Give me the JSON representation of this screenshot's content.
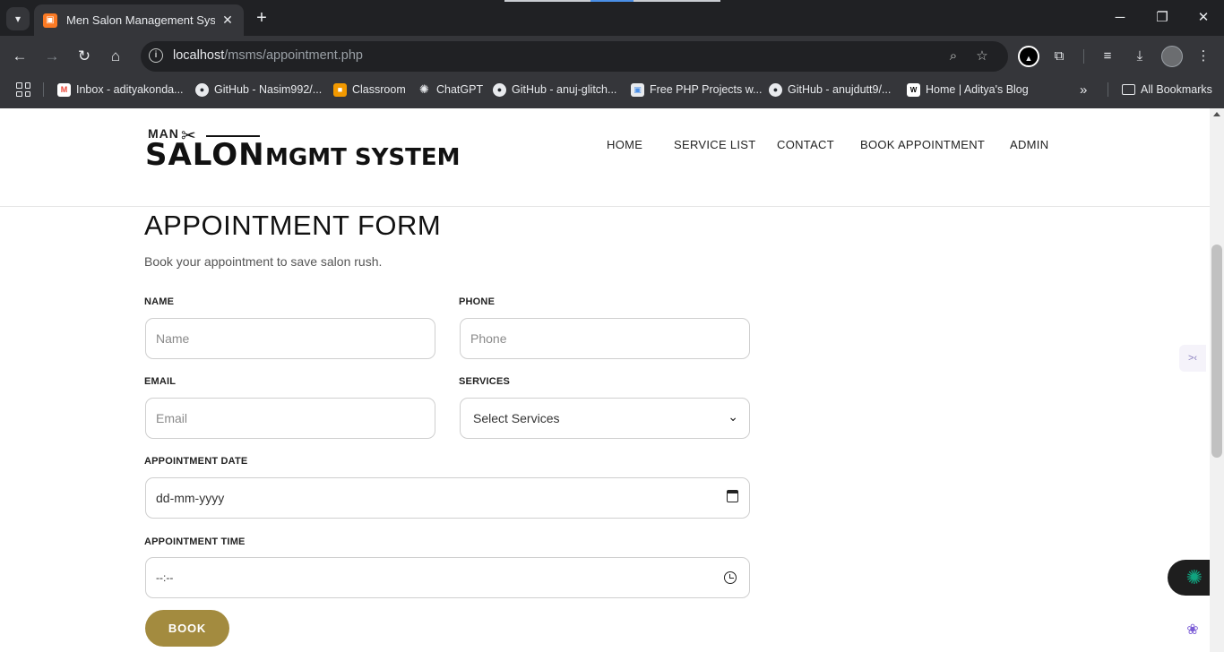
{
  "browser": {
    "tab_title": "Men Salon Management System",
    "tab_favicon_letter": "▣",
    "url_host": "localhost",
    "url_path": "/msms/appointment.php",
    "bookmarks": [
      {
        "label": "Inbox - adityakonda...",
        "icon": "gmail-icon",
        "color": "#ea4335",
        "glyph": "M"
      },
      {
        "label": "GitHub - Nasim992/...",
        "icon": "github-icon",
        "color": "#24292e",
        "glyph": "●"
      },
      {
        "label": "Classroom",
        "icon": "classroom-icon",
        "color": "#f29900",
        "glyph": "■"
      },
      {
        "label": "ChatGPT",
        "icon": "chatgpt-icon",
        "color": "#35363a",
        "glyph": "✺"
      },
      {
        "label": "GitHub - anuj-glitch...",
        "icon": "github-icon",
        "color": "#24292e",
        "glyph": "●"
      },
      {
        "label": "Free PHP Projects w...",
        "icon": "php-icon",
        "color": "#e8eaed",
        "glyph": "▣"
      },
      {
        "label": "GitHub - anujdutt9/...",
        "icon": "github-icon",
        "color": "#24292e",
        "glyph": "●"
      },
      {
        "label": "Home | Aditya's Blog",
        "icon": "wix-icon",
        "color": "#ffffff",
        "glyph": "W"
      }
    ],
    "all_bookmarks": "All Bookmarks"
  },
  "site": {
    "logo_man": "MAN",
    "logo_salon": "SALON",
    "logo_mgmt": "MGMT SYSTEM",
    "nav": [
      "HOME",
      "SERVICE LIST",
      "CONTACT",
      "BOOK APPOINTMENT",
      "ADMIN"
    ]
  },
  "form": {
    "title": "APPOINTMENT FORM",
    "subtitle": "Book your appointment to save salon rush.",
    "name_label": "NAME",
    "name_placeholder": "Name",
    "phone_label": "PHONE",
    "phone_placeholder": "Phone",
    "email_label": "EMAIL",
    "email_placeholder": "Email",
    "services_label": "SERVICES",
    "services_selected": "Select Services",
    "date_label": "APPOINTMENT DATE",
    "date_value": "dd-mm-yyyy",
    "time_label": "APPOINTMENT TIME",
    "time_value": "--:--",
    "submit": "BOOK"
  },
  "colors": {
    "accent": "#a38b3f",
    "chrome_dark": "#202124",
    "chrome": "#35363a"
  }
}
